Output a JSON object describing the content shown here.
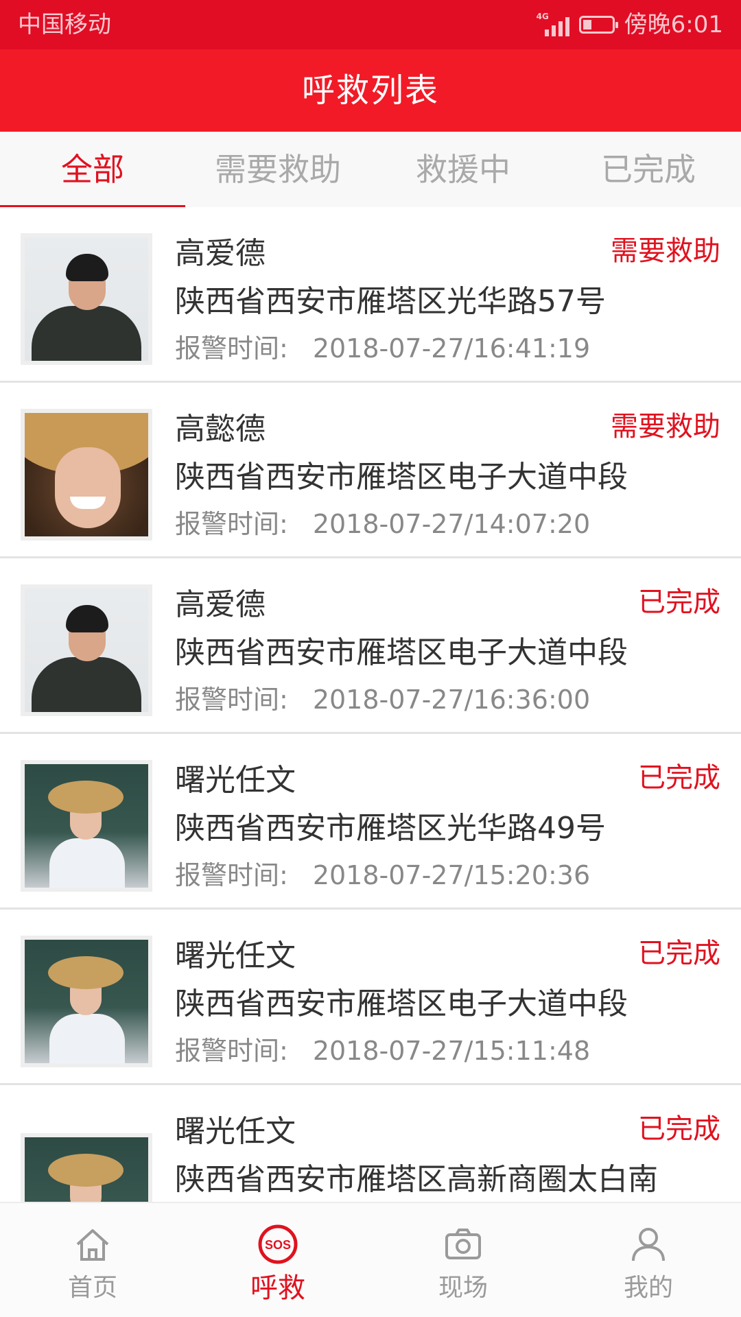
{
  "status_bar": {
    "carrier": "中国移动",
    "network": "4G",
    "time": "傍晚6:01"
  },
  "header": {
    "title": "呼救列表"
  },
  "tabs": [
    {
      "label": "全部",
      "active": true
    },
    {
      "label": "需要救助",
      "active": false
    },
    {
      "label": "救援中",
      "active": false
    },
    {
      "label": "已完成",
      "active": false
    }
  ],
  "list": {
    "time_label": "报警时间:",
    "items": [
      {
        "name": "高爱德",
        "status": "需要救助",
        "address": "陕西省西安市雁塔区光华路57号",
        "time": "2018-07-27/16:41:19"
      },
      {
        "name": "高懿德",
        "status": "需要救助",
        "address": "陕西省西安市雁塔区电子大道中段",
        "time": "2018-07-27/14:07:20"
      },
      {
        "name": "高爱德",
        "status": "已完成",
        "address": "陕西省西安市雁塔区电子大道中段",
        "time": "2018-07-27/16:36:00"
      },
      {
        "name": "曙光任文",
        "status": "已完成",
        "address": "陕西省西安市雁塔区光华路49号",
        "time": "2018-07-27/15:20:36"
      },
      {
        "name": "曙光任文",
        "status": "已完成",
        "address": "陕西省西安市雁塔区电子大道中段",
        "time": "2018-07-27/15:11:48"
      },
      {
        "name": "曙光任文",
        "status": "已完成",
        "address": "陕西省西安市雁塔区高新商圈太白南",
        "time": ""
      }
    ]
  },
  "bottom_nav": [
    {
      "label": "首页",
      "icon": "home-icon",
      "active": false
    },
    {
      "label": "呼救",
      "icon": "sos-icon",
      "active": true,
      "icon_text": "SOS"
    },
    {
      "label": "现场",
      "icon": "camera-icon",
      "active": false
    },
    {
      "label": "我的",
      "icon": "user-icon",
      "active": false
    }
  ],
  "colors": {
    "status_bar_bg": "#e10d25",
    "header_bg": "#f21a26",
    "accent": "#e0121f",
    "inactive_text": "#a9a9a9"
  }
}
